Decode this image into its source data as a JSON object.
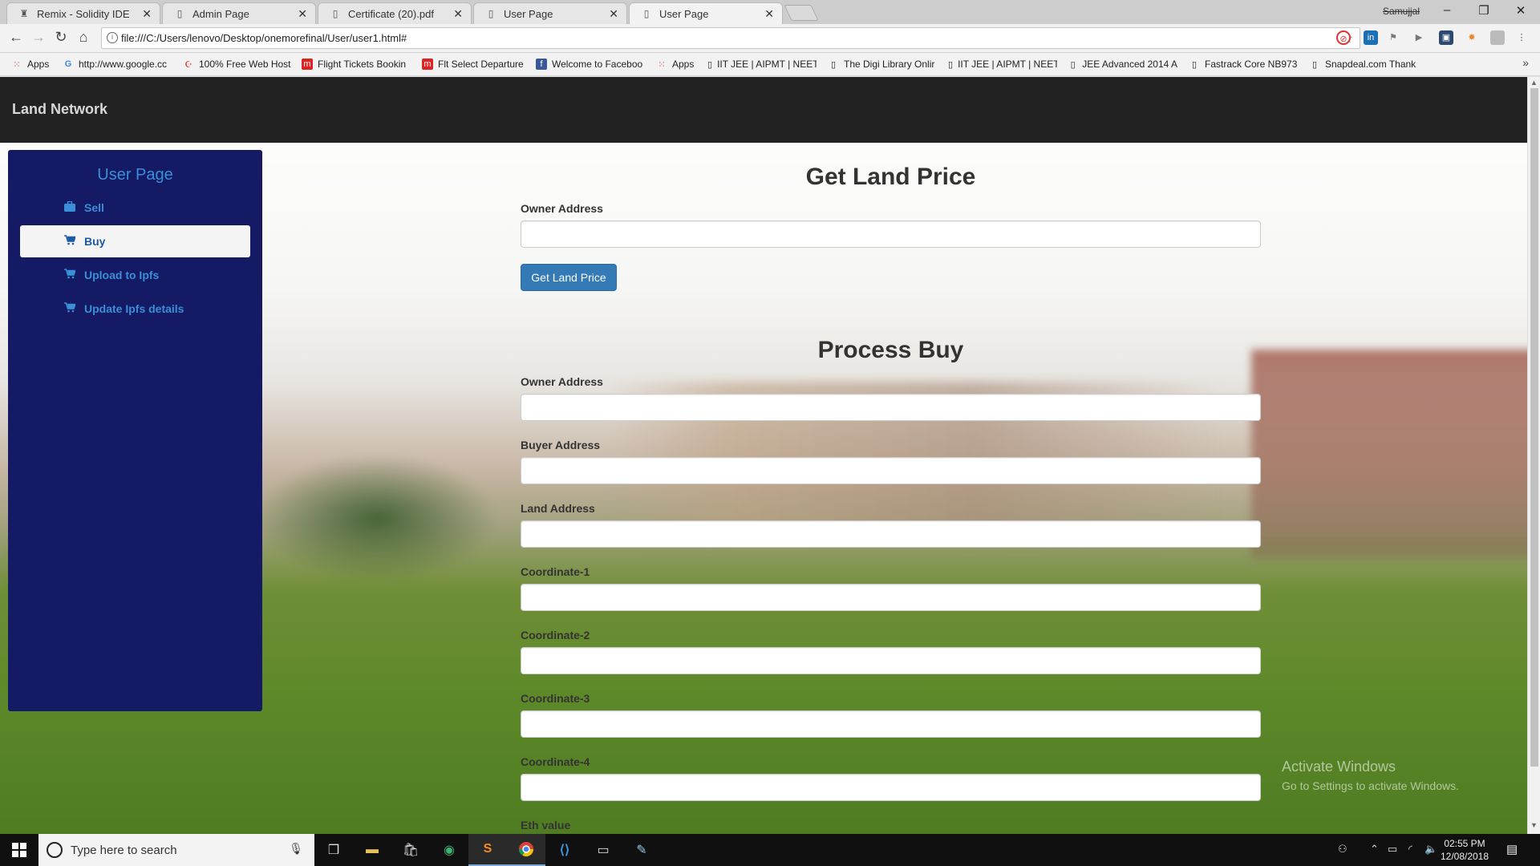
{
  "browser": {
    "tabs": [
      {
        "title": "Remix - Solidity IDE",
        "icon": "remix-icon"
      },
      {
        "title": "Admin Page",
        "icon": "page-icon"
      },
      {
        "title": "Certificate (20).pdf",
        "icon": "page-icon"
      },
      {
        "title": "User Page",
        "icon": "page-icon"
      },
      {
        "title": "User Page",
        "icon": "page-icon",
        "active": true
      }
    ],
    "profile_name": "Samujjal",
    "url": "file:///C:/Users/lenovo/Desktop/onemorefinal/User/user1.html#",
    "bookmarks": [
      {
        "label": "Apps",
        "icon": "apps-grid-icon"
      },
      {
        "label": "http://www.google.cc",
        "icon": "google-icon"
      },
      {
        "label": "100% Free Web Host",
        "icon": "webhost-icon"
      },
      {
        "label": "Flight Tickets Bookin",
        "icon": "makemytrip-icon"
      },
      {
        "label": "Flt Select Departure",
        "icon": "makemytrip-icon"
      },
      {
        "label": "Welcome to Faceboo",
        "icon": "facebook-icon"
      },
      {
        "label": "Apps",
        "icon": "apps-grid-icon"
      },
      {
        "label": "IIT JEE | AIPMT | NEET",
        "icon": "page-icon"
      },
      {
        "label": "The Digi Library Onlir",
        "icon": "page-icon"
      },
      {
        "label": "IIT JEE | AIPMT | NEET",
        "icon": "page-icon"
      },
      {
        "label": "JEE Advanced 2014 A",
        "icon": "page-icon"
      },
      {
        "label": "Fastrack Core NB973",
        "icon": "page-icon"
      },
      {
        "label": "Snapdeal.com Thank",
        "icon": "page-icon"
      }
    ],
    "more_symbol": "»"
  },
  "app": {
    "brand": "Land Network",
    "sidebar": {
      "title": "User Page",
      "items": [
        {
          "label": "Sell",
          "icon": "briefcase-icon",
          "active": false
        },
        {
          "label": "Buy",
          "icon": "cart-icon",
          "active": true
        },
        {
          "label": "Upload to Ipfs",
          "icon": "cart-icon",
          "active": false
        },
        {
          "label": "Update Ipfs details",
          "icon": "cart-icon",
          "active": false
        }
      ]
    },
    "get_price": {
      "heading": "Get Land Price",
      "owner_label": "Owner Address",
      "owner_value": "",
      "button": "Get Land Price"
    },
    "process_buy": {
      "heading": "Process Buy",
      "fields": [
        {
          "label": "Owner Address",
          "value": ""
        },
        {
          "label": "Buyer Address",
          "value": ""
        },
        {
          "label": "Land Address",
          "value": ""
        },
        {
          "label": "Coordinate-1",
          "value": ""
        },
        {
          "label": "Coordinate-2",
          "value": ""
        },
        {
          "label": "Coordinate-3",
          "value": ""
        },
        {
          "label": "Coordinate-4",
          "value": ""
        }
      ],
      "cut_off_label": "Eth value"
    }
  },
  "os": {
    "watermark_title": "Activate Windows",
    "watermark_sub": "Go to Settings to activate Windows.",
    "search_placeholder": "Type here to search",
    "time": "02:55 PM",
    "date": "12/08/2018"
  }
}
